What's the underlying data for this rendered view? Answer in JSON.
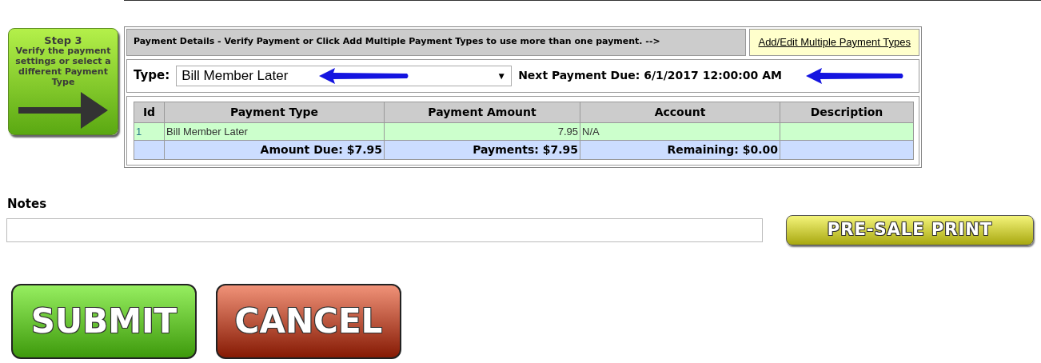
{
  "step_box": {
    "title": "Step 3",
    "text": "Verify the payment settings or select a different Payment Type"
  },
  "payment_details": {
    "heading": "Payment Details - Verify Payment or Click Add Multiple Payment Types to use more than one payment. -->",
    "link": "Add/Edit Multiple Payment Types"
  },
  "type_field": {
    "label": "Type:",
    "value": "Bill Member Later",
    "caret": "▼"
  },
  "next_payment": "Next Payment Due: 6/1/2017 12:00:00 AM",
  "table": {
    "columns": [
      "Id",
      "Payment Type",
      "Payment Amount",
      "Account",
      "Description"
    ],
    "rows": [
      {
        "kind": "payment",
        "id": "1",
        "payment_type": "Bill Member Later",
        "amount": "7.95",
        "account": "N/A"
      },
      {
        "kind": "totals",
        "amount_due": "Amount Due: $7.95",
        "payments": "Payments: $7.95",
        "remaining": "Remaining: $0.00"
      }
    ]
  },
  "notes": {
    "label": "Notes"
  },
  "buttons": [
    {
      "kind": "print",
      "label": "PRE-SALE PRINT"
    },
    {
      "kind": "submit",
      "label": "SUBMIT"
    },
    {
      "kind": "cancel",
      "label": "CANCEL"
    }
  ]
}
